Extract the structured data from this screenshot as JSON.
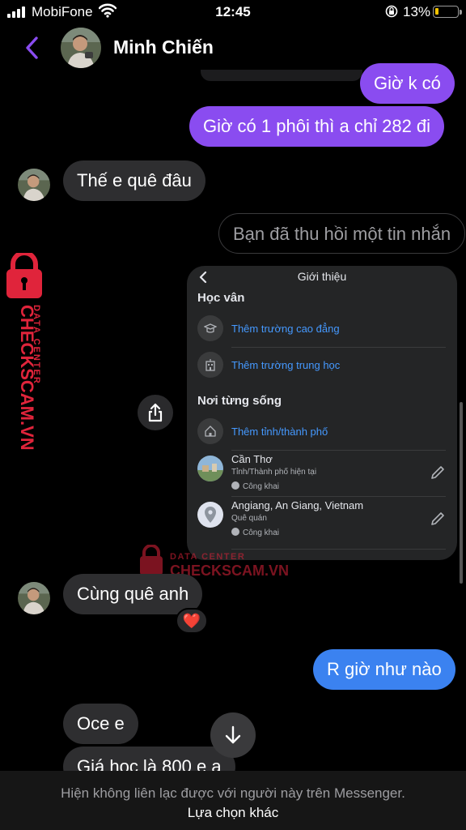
{
  "status_bar": {
    "carrier": "MobiFone",
    "time": "12:45",
    "battery_percent": "13%",
    "battery_level": 0.13,
    "icons": [
      "signal-icon",
      "wifi-icon",
      "rotation-lock-icon",
      "battery-icon"
    ]
  },
  "header": {
    "contact_name": "Minh Chiến",
    "back_icon": "chevron-left-icon"
  },
  "messages": [
    {
      "side": "sent",
      "text": "Giờ k có"
    },
    {
      "side": "sent",
      "text": "Giờ có 1 phôi thì a chỉ 282 đi"
    },
    {
      "side": "received",
      "text": "Thế e quê đâu"
    },
    {
      "side": "sent",
      "text": "Bạn đã thu hồi một tin nhắn",
      "unsent": true
    },
    {
      "side": "sent",
      "type": "image",
      "description": "screenshot"
    },
    {
      "side": "received",
      "text": "Cùng quê anh",
      "reaction": "❤️"
    },
    {
      "side": "sent",
      "text": "R giờ như nào"
    },
    {
      "side": "received",
      "text": "Oce e"
    },
    {
      "side": "received",
      "text": "Giá học là 800 e a"
    }
  ],
  "screenshot": {
    "title": "Giới thiệu",
    "section_education": "Học vân",
    "add_college": "Thêm trường cao đẳng",
    "add_highschool": "Thêm trường trung học",
    "section_lived": "Nơi từng sống",
    "add_city": "Thêm tỉnh/thành phố",
    "current_city_name": "Cần Thơ",
    "current_city_sub": "Tỉnh/Thành phố hiện tại",
    "current_city_privacy": "Công khai",
    "hometown_name": "Angiang, An Giang, Vietnam",
    "hometown_sub": "Quê quán",
    "hometown_privacy": "Công khai"
  },
  "watermark": {
    "brand_side_line1": "CHECKSCAM.VN",
    "brand_side_line2": "DATA CENTER",
    "brand_mid_line1": "DATA CENTER",
    "brand_mid_line2": "CHECKSCAM.VN"
  },
  "footer": {
    "info_text": "Hiện không liên lạc được với người này trên Messenger.",
    "action_text": "Lựa chọn khác"
  },
  "colors": {
    "sent_bubble": "#8a4cf0",
    "sent_bubble_latest": "#3b82f0",
    "received_bubble": "#2e2e30",
    "accent": "#8a4cf0",
    "link_blue": "#4599ff",
    "watermark_red": "#e0243b"
  }
}
